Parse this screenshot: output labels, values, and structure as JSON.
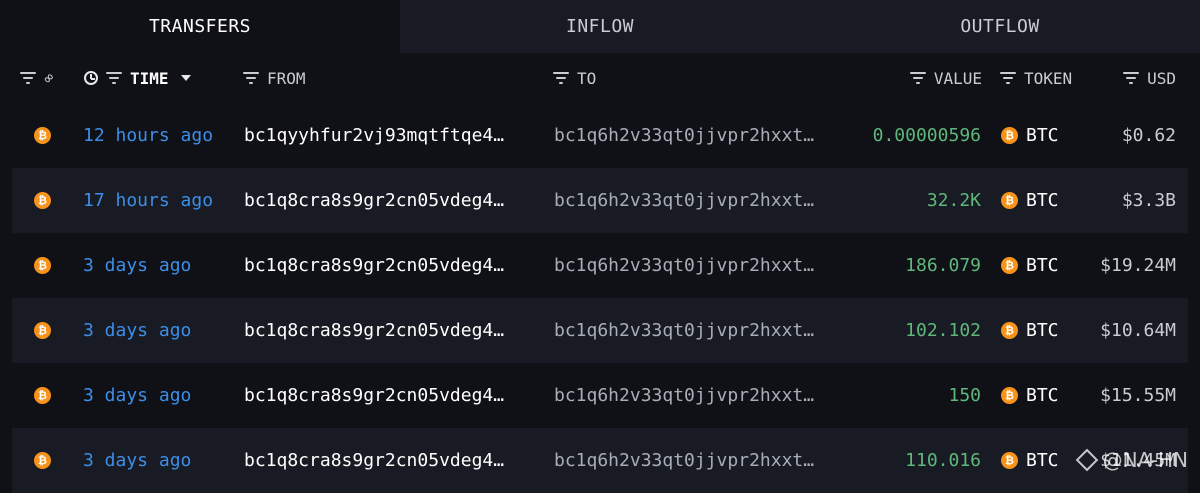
{
  "tabs": [
    "TRANSFERS",
    "INFLOW",
    "OUTFLOW"
  ],
  "active_tab": 0,
  "columns": {
    "time": "TIME",
    "from": "FROM",
    "to": "TO",
    "value": "VALUE",
    "token": "TOKEN",
    "usd": "USD"
  },
  "rows": [
    {
      "time": "12 hours ago",
      "from": "bc1qyyhfur2vj93mqtftqe4…",
      "to": "bc1q6h2v33qt0jjvpr2hxxt…",
      "value": "0.00000596",
      "token": "BTC",
      "usd": "$0.62"
    },
    {
      "time": "17 hours ago",
      "from": "bc1q8cra8s9gr2cn05vdeg4…",
      "to": "bc1q6h2v33qt0jjvpr2hxxt…",
      "value": "32.2K",
      "token": "BTC",
      "usd": "$3.3B"
    },
    {
      "time": "3 days ago",
      "from": "bc1q8cra8s9gr2cn05vdeg4…",
      "to": "bc1q6h2v33qt0jjvpr2hxxt…",
      "value": "186.079",
      "token": "BTC",
      "usd": "$19.24M"
    },
    {
      "time": "3 days ago",
      "from": "bc1q8cra8s9gr2cn05vdeg4…",
      "to": "bc1q6h2v33qt0jjvpr2hxxt…",
      "value": "102.102",
      "token": "BTC",
      "usd": "$10.64M"
    },
    {
      "time": "3 days ago",
      "from": "bc1q8cra8s9gr2cn05vdeg4…",
      "to": "bc1q6h2v33qt0jjvpr2hxxt…",
      "value": "150",
      "token": "BTC",
      "usd": "$15.55M"
    },
    {
      "time": "3 days ago",
      "from": "bc1q8cra8s9gr2cn05vdeg4…",
      "to": "bc1q6h2v33qt0jjvpr2hxxt…",
      "value": "110.016",
      "token": "BTC",
      "usd": "$11.45M"
    }
  ],
  "token_icon": "bitcoin-icon",
  "watermark": "@NA-HN",
  "colors": {
    "background": "#0f1117",
    "row_alt": "#181b23",
    "time_link": "#3c8ee8",
    "value_green": "#5fb77a",
    "btc_orange": "#f7931a"
  }
}
